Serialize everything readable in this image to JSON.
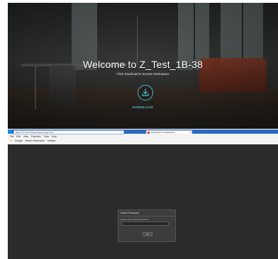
{
  "welcome": {
    "title": "Welcome to  Z_Test_1B-38",
    "subtitle": "Click download to access Workspace",
    "download_label": "DOWNLOAD",
    "accent_color": "#3fc0d8",
    "download_icon": "download-icon"
  },
  "browser": {
    "address": "https://172.16.8.35/workspace/login.html",
    "tab_title": "Workspace Configuration",
    "menu": [
      "File",
      "Edit",
      "View",
      "Favorites",
      "Tools",
      "Help"
    ],
    "favorites": [
      "Google",
      "Search Extensions",
      "Surface"
    ]
  },
  "dialog": {
    "title": "Admin Password",
    "prompt": "Please enter admin password",
    "input_value": "|",
    "ok_label": "OK"
  }
}
